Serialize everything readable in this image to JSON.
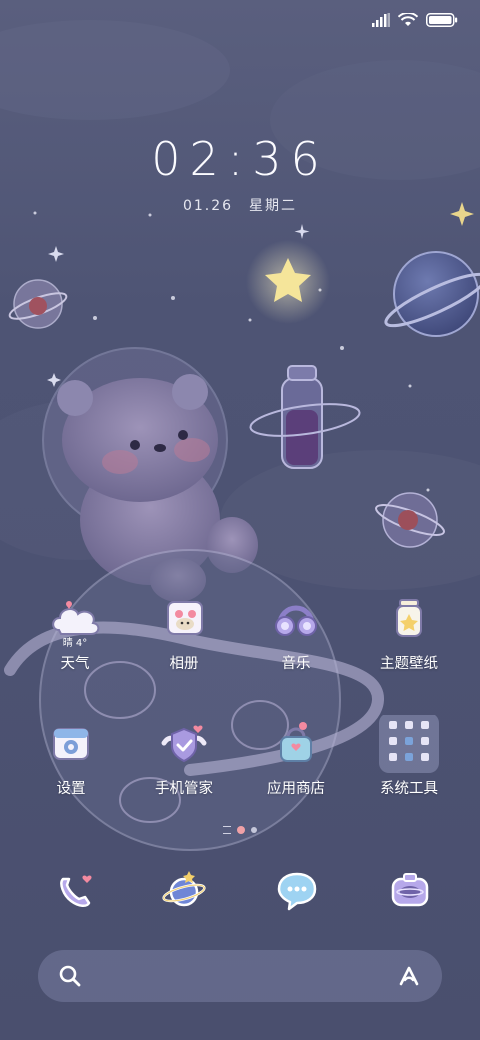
{
  "status_bar": {
    "signal_icon": "signal-icon",
    "wifi_icon": "wifi-icon",
    "battery_icon": "battery-icon"
  },
  "lockscreen": {
    "time": "02:36",
    "date": "01.26",
    "weekday": "星期二"
  },
  "apps": [
    {
      "id": "weather",
      "label": "天气",
      "icon": "weather-cloud-icon",
      "badge": "晴 4°"
    },
    {
      "id": "gallery",
      "label": "相册",
      "icon": "gallery-icon"
    },
    {
      "id": "music",
      "label": "音乐",
      "icon": "headphones-icon"
    },
    {
      "id": "themes",
      "label": "主题壁纸",
      "icon": "jar-icon"
    },
    {
      "id": "settings",
      "label": "设置",
      "icon": "settings-icon"
    },
    {
      "id": "security",
      "label": "手机管家",
      "icon": "shield-icon"
    },
    {
      "id": "appstore",
      "label": "应用商店",
      "icon": "shopping-bag-icon"
    },
    {
      "id": "tools",
      "label": "系统工具",
      "icon": "folder-icon"
    }
  ],
  "dock": [
    {
      "id": "phone",
      "icon": "phone-icon"
    },
    {
      "id": "browser",
      "icon": "planet-icon"
    },
    {
      "id": "messages",
      "icon": "chat-bubble-icon"
    },
    {
      "id": "camera",
      "icon": "camera-icon"
    }
  ],
  "search_bar": {
    "search_icon": "search-icon",
    "assistant_icon": "assistant-icon"
  },
  "colors": {
    "background": "#4e5474",
    "accent": "#a89ce0",
    "text": "#ffffff"
  }
}
